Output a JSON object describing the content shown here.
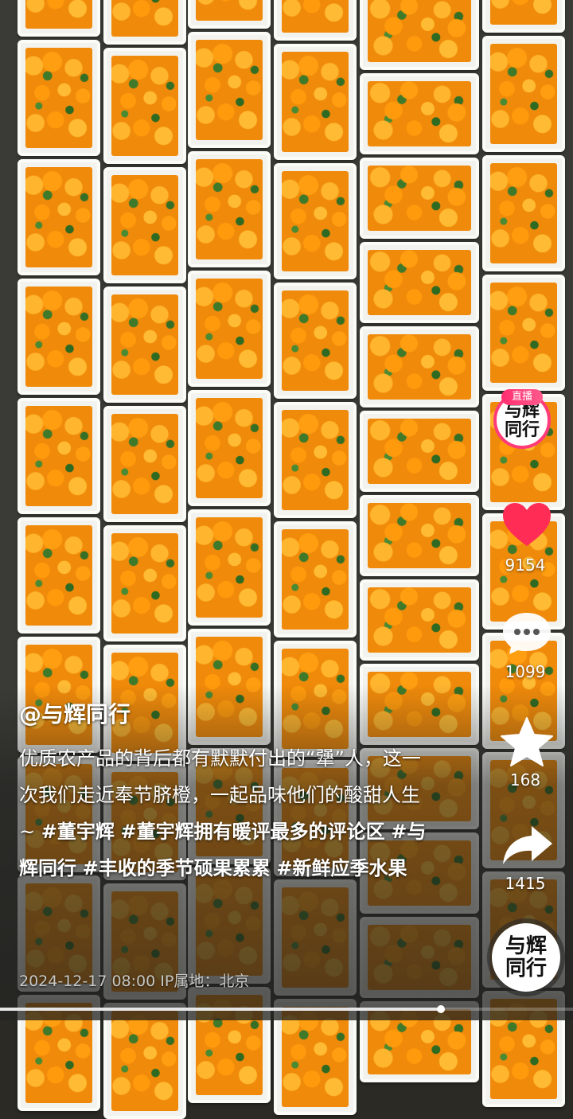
{
  "author": "@与辉同行",
  "caption_text": "优质农产品的背后都有默默付出的“犟”人，这一次我们走近奉节脐橙，一起品味他们的酸甜人生 ~ ",
  "hashtags": [
    "#董宇辉",
    "#董宇辉拥有暖评最多的评论区",
    "#与辉同行",
    "#丰收的季节硕果累累",
    "#新鲜应季水果"
  ],
  "meta": "2024-12-17 08:00  IP属地：北京",
  "live_badge": "直播",
  "avatar_text": "与辉同行",
  "likes": "9154",
  "comments": "1099",
  "favorites": "168",
  "shares": "1415",
  "progress_fraction": 0.77,
  "colors": {
    "like": "#ff2d55",
    "live": "#ff3b7a"
  },
  "icons": [
    "heart-icon",
    "comment-icon",
    "star-icon",
    "share-icon"
  ]
}
